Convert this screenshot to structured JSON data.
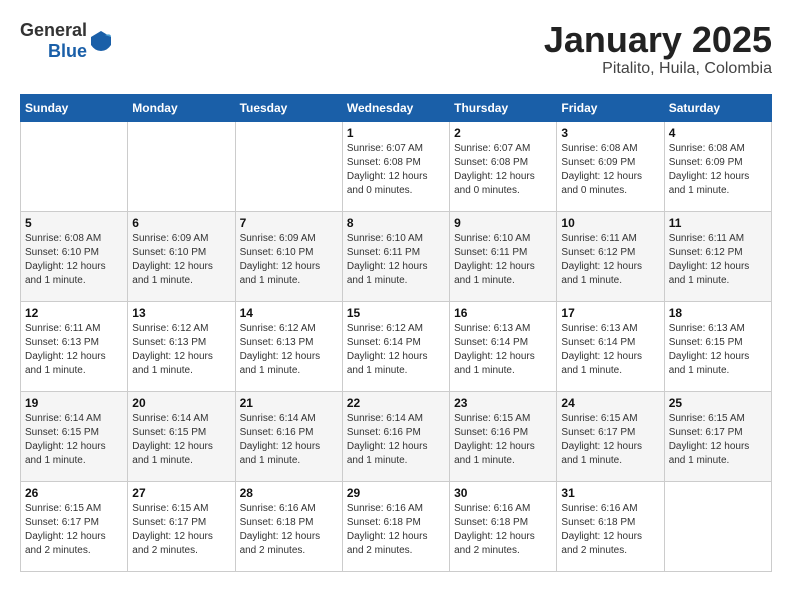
{
  "header": {
    "logo_general": "General",
    "logo_blue": "Blue",
    "title": "January 2025",
    "subtitle": "Pitalito, Huila, Colombia"
  },
  "days_of_week": [
    "Sunday",
    "Monday",
    "Tuesday",
    "Wednesday",
    "Thursday",
    "Friday",
    "Saturday"
  ],
  "weeks": [
    [
      {
        "day": "",
        "info": ""
      },
      {
        "day": "",
        "info": ""
      },
      {
        "day": "",
        "info": ""
      },
      {
        "day": "1",
        "info": "Sunrise: 6:07 AM\nSunset: 6:08 PM\nDaylight: 12 hours and 0 minutes."
      },
      {
        "day": "2",
        "info": "Sunrise: 6:07 AM\nSunset: 6:08 PM\nDaylight: 12 hours and 0 minutes."
      },
      {
        "day": "3",
        "info": "Sunrise: 6:08 AM\nSunset: 6:09 PM\nDaylight: 12 hours and 0 minutes."
      },
      {
        "day": "4",
        "info": "Sunrise: 6:08 AM\nSunset: 6:09 PM\nDaylight: 12 hours and 1 minute."
      }
    ],
    [
      {
        "day": "5",
        "info": "Sunrise: 6:08 AM\nSunset: 6:10 PM\nDaylight: 12 hours and 1 minute."
      },
      {
        "day": "6",
        "info": "Sunrise: 6:09 AM\nSunset: 6:10 PM\nDaylight: 12 hours and 1 minute."
      },
      {
        "day": "7",
        "info": "Sunrise: 6:09 AM\nSunset: 6:10 PM\nDaylight: 12 hours and 1 minute."
      },
      {
        "day": "8",
        "info": "Sunrise: 6:10 AM\nSunset: 6:11 PM\nDaylight: 12 hours and 1 minute."
      },
      {
        "day": "9",
        "info": "Sunrise: 6:10 AM\nSunset: 6:11 PM\nDaylight: 12 hours and 1 minute."
      },
      {
        "day": "10",
        "info": "Sunrise: 6:11 AM\nSunset: 6:12 PM\nDaylight: 12 hours and 1 minute."
      },
      {
        "day": "11",
        "info": "Sunrise: 6:11 AM\nSunset: 6:12 PM\nDaylight: 12 hours and 1 minute."
      }
    ],
    [
      {
        "day": "12",
        "info": "Sunrise: 6:11 AM\nSunset: 6:13 PM\nDaylight: 12 hours and 1 minute."
      },
      {
        "day": "13",
        "info": "Sunrise: 6:12 AM\nSunset: 6:13 PM\nDaylight: 12 hours and 1 minute."
      },
      {
        "day": "14",
        "info": "Sunrise: 6:12 AM\nSunset: 6:13 PM\nDaylight: 12 hours and 1 minute."
      },
      {
        "day": "15",
        "info": "Sunrise: 6:12 AM\nSunset: 6:14 PM\nDaylight: 12 hours and 1 minute."
      },
      {
        "day": "16",
        "info": "Sunrise: 6:13 AM\nSunset: 6:14 PM\nDaylight: 12 hours and 1 minute."
      },
      {
        "day": "17",
        "info": "Sunrise: 6:13 AM\nSunset: 6:14 PM\nDaylight: 12 hours and 1 minute."
      },
      {
        "day": "18",
        "info": "Sunrise: 6:13 AM\nSunset: 6:15 PM\nDaylight: 12 hours and 1 minute."
      }
    ],
    [
      {
        "day": "19",
        "info": "Sunrise: 6:14 AM\nSunset: 6:15 PM\nDaylight: 12 hours and 1 minute."
      },
      {
        "day": "20",
        "info": "Sunrise: 6:14 AM\nSunset: 6:15 PM\nDaylight: 12 hours and 1 minute."
      },
      {
        "day": "21",
        "info": "Sunrise: 6:14 AM\nSunset: 6:16 PM\nDaylight: 12 hours and 1 minute."
      },
      {
        "day": "22",
        "info": "Sunrise: 6:14 AM\nSunset: 6:16 PM\nDaylight: 12 hours and 1 minute."
      },
      {
        "day": "23",
        "info": "Sunrise: 6:15 AM\nSunset: 6:16 PM\nDaylight: 12 hours and 1 minute."
      },
      {
        "day": "24",
        "info": "Sunrise: 6:15 AM\nSunset: 6:17 PM\nDaylight: 12 hours and 1 minute."
      },
      {
        "day": "25",
        "info": "Sunrise: 6:15 AM\nSunset: 6:17 PM\nDaylight: 12 hours and 1 minute."
      }
    ],
    [
      {
        "day": "26",
        "info": "Sunrise: 6:15 AM\nSunset: 6:17 PM\nDaylight: 12 hours and 2 minutes."
      },
      {
        "day": "27",
        "info": "Sunrise: 6:15 AM\nSunset: 6:17 PM\nDaylight: 12 hours and 2 minutes."
      },
      {
        "day": "28",
        "info": "Sunrise: 6:16 AM\nSunset: 6:18 PM\nDaylight: 12 hours and 2 minutes."
      },
      {
        "day": "29",
        "info": "Sunrise: 6:16 AM\nSunset: 6:18 PM\nDaylight: 12 hours and 2 minutes."
      },
      {
        "day": "30",
        "info": "Sunrise: 6:16 AM\nSunset: 6:18 PM\nDaylight: 12 hours and 2 minutes."
      },
      {
        "day": "31",
        "info": "Sunrise: 6:16 AM\nSunset: 6:18 PM\nDaylight: 12 hours and 2 minutes."
      },
      {
        "day": "",
        "info": ""
      }
    ]
  ]
}
